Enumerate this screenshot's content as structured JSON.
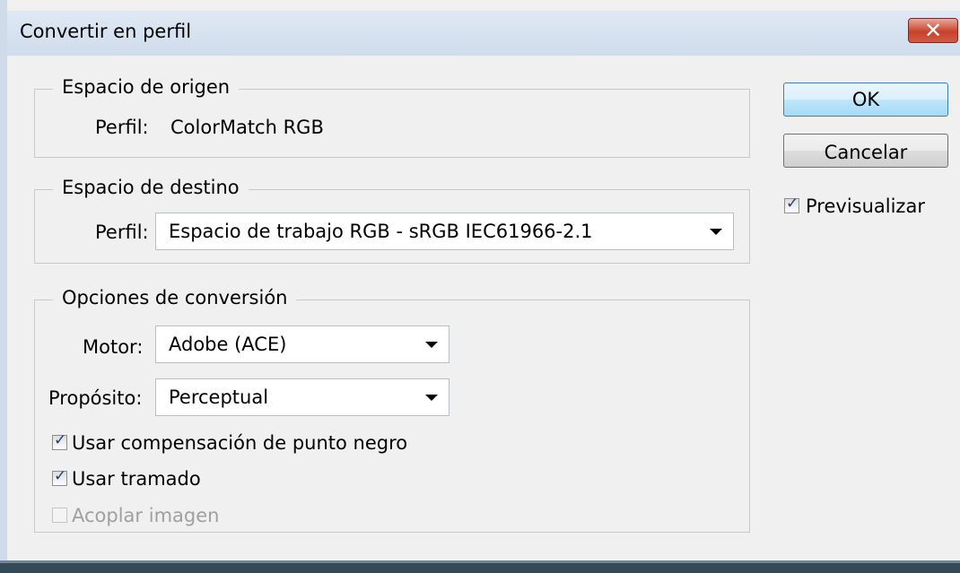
{
  "window": {
    "title": "Convertir en perfil",
    "close_label": "✕"
  },
  "source": {
    "legend": "Espacio de origen",
    "profile_label": "Perfil:",
    "profile_value": "ColorMatch RGB"
  },
  "destination": {
    "legend": "Espacio de destino",
    "profile_label": "Perfil:",
    "profile_value": "Espacio de trabajo RGB - sRGB IEC61966-2.1"
  },
  "options": {
    "legend": "Opciones de conversión",
    "engine_label": "Motor:",
    "engine_value": "Adobe (ACE)",
    "intent_label": "Propósito:",
    "intent_value": "Perceptual",
    "black_point_label": "Usar compensación de punto negro",
    "black_point_checked": true,
    "dither_label": "Usar tramado",
    "dither_checked": true,
    "flatten_label": "Acoplar imagen",
    "flatten_checked": false,
    "flatten_enabled": false
  },
  "buttons": {
    "ok": "OK",
    "cancel": "Cancelar"
  },
  "preview": {
    "label": "Previsualizar",
    "checked": true
  }
}
